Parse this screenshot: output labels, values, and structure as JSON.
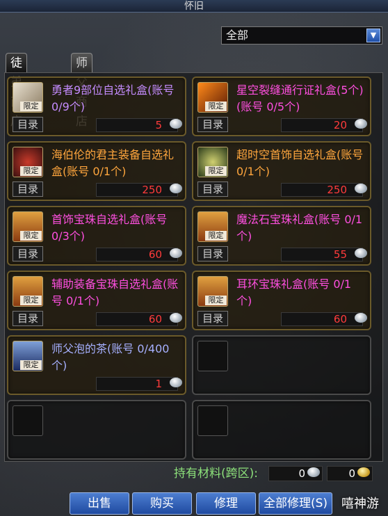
{
  "window": {
    "title": "怀旧"
  },
  "filter": {
    "selected": "全部"
  },
  "tabs": [
    {
      "label": "徒弟商店"
    },
    {
      "label": "师父商店"
    }
  ],
  "items": [
    {
      "name": "勇者9部位自选礼盒(账号 0/9个)",
      "tag": "限定",
      "catalog": "目录",
      "price": "5",
      "color": "purple"
    },
    {
      "name": "星空裂缝通行证礼盒(5个)(账号 0/5个)",
      "tag": "限定",
      "catalog": "目录",
      "price": "20",
      "color": "magenta"
    },
    {
      "name": "海伯伦的君主装备自选礼盒(账号 0/1个)",
      "tag": "限定",
      "catalog": "目录",
      "price": "250",
      "color": "orange"
    },
    {
      "name": "超时空首饰自选礼盒(账号 0/1个)",
      "tag": "限定",
      "catalog": "目录",
      "price": "250",
      "color": "orange"
    },
    {
      "name": "首饰宝珠自选礼盒(账号 0/3个)",
      "tag": "限定",
      "catalog": "目录",
      "price": "60",
      "color": "magenta"
    },
    {
      "name": "魔法石宝珠礼盒(账号 0/1个)",
      "tag": "限定",
      "catalog": "目录",
      "price": "55",
      "color": "magenta"
    },
    {
      "name": "辅助装备宝珠自选礼盒(账号 0/1个)",
      "tag": "限定",
      "catalog": "目录",
      "price": "60",
      "color": "magenta"
    },
    {
      "name": "耳环宝珠礼盒(账号 0/1个)",
      "tag": "限定",
      "catalog": "目录",
      "price": "60",
      "color": "magenta"
    },
    {
      "name": "师父泡的茶(账号 0/400个)",
      "tag": "限定",
      "catalog": "",
      "price": "1",
      "color": "blue"
    }
  ],
  "footer": {
    "holding_label": "持有材料(跨区):",
    "material_count": "0",
    "gold_count": "0",
    "buttons": [
      "出售",
      "购买",
      "修理",
      "全部修理(S)"
    ]
  },
  "watermark": "嘻神游",
  "colors": {
    "accent": "#2f63c4",
    "price": "#ff3b3b",
    "holding": "#8ce07a"
  }
}
